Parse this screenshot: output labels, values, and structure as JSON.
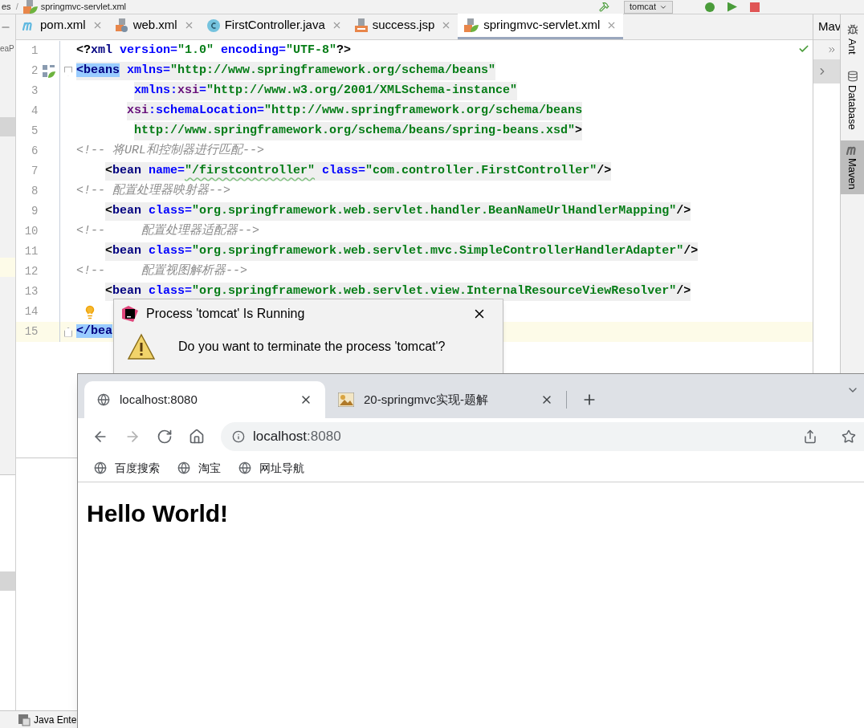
{
  "toolbar": {
    "breadcrumb": [
      "es",
      "springmvc-servlet.xml"
    ],
    "separator": "/",
    "run_config": "tomcat"
  },
  "project_panel": {
    "label": "eaP"
  },
  "editor_tabs": [
    {
      "label": "pom.xml",
      "selected": false
    },
    {
      "label": "web.xml",
      "selected": false
    },
    {
      "label": "FirstController.java",
      "selected": false
    },
    {
      "label": "success.jsp",
      "selected": false
    },
    {
      "label": "springmvc-servlet.xml",
      "selected": true
    }
  ],
  "tool_window": {
    "title": "Mav"
  },
  "side_tabs": [
    {
      "label": "Ant",
      "selected": false
    },
    {
      "label": "Database",
      "selected": false
    },
    {
      "label": "Maven",
      "selected": true
    }
  ],
  "code_lines": [
    {
      "number": "1",
      "kind": "prolog",
      "current": false,
      "segments": [
        {
          "kind": "punct",
          "text": "<?"
        },
        {
          "kind": "tag",
          "text": "xml"
        },
        {
          "kind": "attr",
          "text": " version="
        },
        {
          "kind": "value",
          "text": "\"1.0\""
        },
        {
          "kind": "attr",
          "text": " encoding="
        },
        {
          "kind": "value",
          "text": "\"UTF-8\""
        },
        {
          "kind": "punct",
          "text": "?>"
        }
      ]
    },
    {
      "number": "2",
      "kind": "element",
      "current": false,
      "segments": [
        {
          "kind": "match",
          "text": "<beans"
        },
        {
          "kind": "attr",
          "text": " xmlns="
        },
        {
          "kind": "value",
          "text": "\"http://www.springframework.org/schema/beans\""
        }
      ]
    },
    {
      "number": "3",
      "kind": "element",
      "current": false,
      "segments": [
        {
          "kind": "attr",
          "text": "        xmlns:"
        },
        {
          "kind": "ns",
          "text": "xsi"
        },
        {
          "kind": "attr",
          "text": "="
        },
        {
          "kind": "value",
          "text": "\"http://www.w3.org/2001/XMLSchema-instance\""
        }
      ]
    },
    {
      "number": "4",
      "kind": "element",
      "current": false,
      "segments": [
        {
          "kind": "ns",
          "text": "       xsi"
        },
        {
          "kind": "attr",
          "text": ":schemaLocation="
        },
        {
          "kind": "value",
          "text": "\"http://www.springframework.org/schema/beans"
        }
      ]
    },
    {
      "number": "5",
      "kind": "element",
      "current": false,
      "segments": [
        {
          "kind": "value",
          "text": "        http://www.springframework.org/schema/beans/spring-beans.xsd\""
        },
        {
          "kind": "punct",
          "text": ">"
        }
      ]
    },
    {
      "number": "6",
      "kind": "comment",
      "current": false,
      "segments": [
        {
          "kind": "comment",
          "text": "<!-- 将URL和控制器进行匹配-->"
        }
      ]
    },
    {
      "number": "7",
      "kind": "element",
      "current": false,
      "segments": [
        {
          "kind": "punct",
          "text": "    <"
        },
        {
          "kind": "tag",
          "text": "bean"
        },
        {
          "kind": "attr",
          "text": " name="
        },
        {
          "kind": "value_typo",
          "text": "\"/firstcontroller\""
        },
        {
          "kind": "attr",
          "text": " class="
        },
        {
          "kind": "value",
          "text": "\"com.controller.FirstController\""
        },
        {
          "kind": "punct",
          "text": "/>"
        }
      ]
    },
    {
      "number": "8",
      "kind": "comment",
      "current": false,
      "segments": [
        {
          "kind": "comment",
          "text": "<!-- 配置处理器映射器-->"
        }
      ]
    },
    {
      "number": "9",
      "kind": "element",
      "current": false,
      "segments": [
        {
          "kind": "punct",
          "text": "    <"
        },
        {
          "kind": "tag",
          "text": "bean"
        },
        {
          "kind": "attr",
          "text": " class="
        },
        {
          "kind": "value",
          "text": "\"org.springframework.web.servlet.handler.BeanNameUrlHandlerMapping\""
        },
        {
          "kind": "punct",
          "text": "/>"
        }
      ]
    },
    {
      "number": "10",
      "kind": "comment",
      "current": false,
      "segments": [
        {
          "kind": "comment",
          "text": "<!--     配置处理器适配器-->"
        }
      ]
    },
    {
      "number": "11",
      "kind": "element",
      "current": false,
      "segments": [
        {
          "kind": "punct",
          "text": "    <"
        },
        {
          "kind": "tag",
          "text": "bean"
        },
        {
          "kind": "attr",
          "text": " class="
        },
        {
          "kind": "value",
          "text": "\"org.springframework.web.servlet.mvc.SimpleControllerHandlerAdapter\""
        },
        {
          "kind": "punct",
          "text": "/>"
        }
      ]
    },
    {
      "number": "12",
      "kind": "comment",
      "current": false,
      "segments": [
        {
          "kind": "comment",
          "text": "<!--     配置视图解析器-->"
        }
      ]
    },
    {
      "number": "13",
      "kind": "element",
      "current": false,
      "segments": [
        {
          "kind": "punct",
          "text": "    <"
        },
        {
          "kind": "tag",
          "text": "bean"
        },
        {
          "kind": "attr",
          "text": " class="
        },
        {
          "kind": "value",
          "text": "\"org.springframework.web.servlet.view.InternalResourceViewResolver\""
        },
        {
          "kind": "punct",
          "text": "/>"
        }
      ]
    },
    {
      "number": "14",
      "kind": "empty",
      "current": false
    },
    {
      "number": "15",
      "kind": "closing",
      "current": true,
      "segments": [
        {
          "kind": "match",
          "text": "</bea"
        }
      ]
    }
  ],
  "bottom_bar": {
    "label": "Java Ente"
  },
  "dialog": {
    "title": "Process 'tomcat' Is Running",
    "message": "Do you want to terminate the process 'tomcat'?"
  },
  "browser": {
    "tabs": [
      {
        "title": "localhost:8080",
        "selected": true
      },
      {
        "title": "20-springmvc实现-题解",
        "selected": false
      }
    ],
    "nav": [
      {
        "kind": "back",
        "disabled": false
      },
      {
        "kind": "forward",
        "disabled": true
      },
      {
        "kind": "reload",
        "disabled": false
      },
      {
        "kind": "home",
        "disabled": false
      }
    ],
    "address": {
      "host": "localhost",
      "port": ":8080"
    },
    "bookmarks": [
      "百度搜索",
      "淘宝",
      "网址导航"
    ],
    "heading": "Hello World!"
  }
}
